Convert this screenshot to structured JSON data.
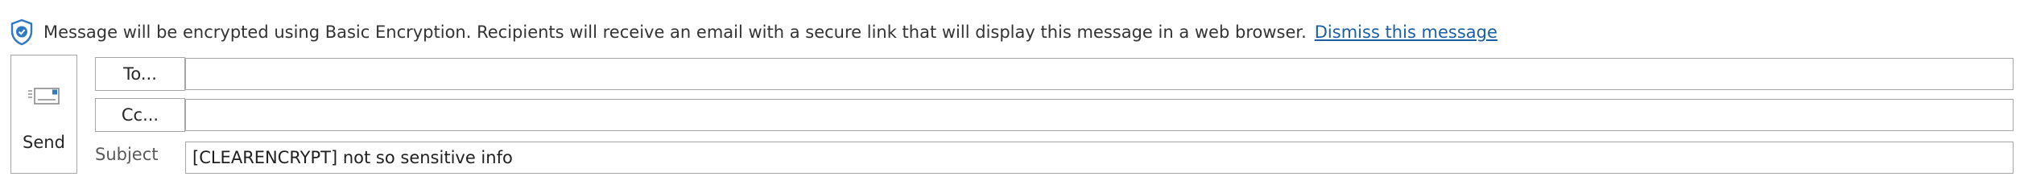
{
  "infobar": {
    "icon": "shield-check-icon",
    "message": "Message will be encrypted using Basic Encryption. Recipients will receive an email with a secure link that will display this message in a web browser.",
    "dismiss_link": "Dismiss this message"
  },
  "send": {
    "icon": "send-envelope-icon",
    "label": "Send"
  },
  "to": {
    "button_label": "To...",
    "value": ""
  },
  "cc": {
    "button_label": "Cc...",
    "value": ""
  },
  "subject": {
    "label": "Subject",
    "value": "[CLEARENCRYPT] not so sensitive info"
  },
  "colors": {
    "link": "#1a5fa6",
    "shield": "#2f78c4",
    "border": "#a6a6a6"
  }
}
